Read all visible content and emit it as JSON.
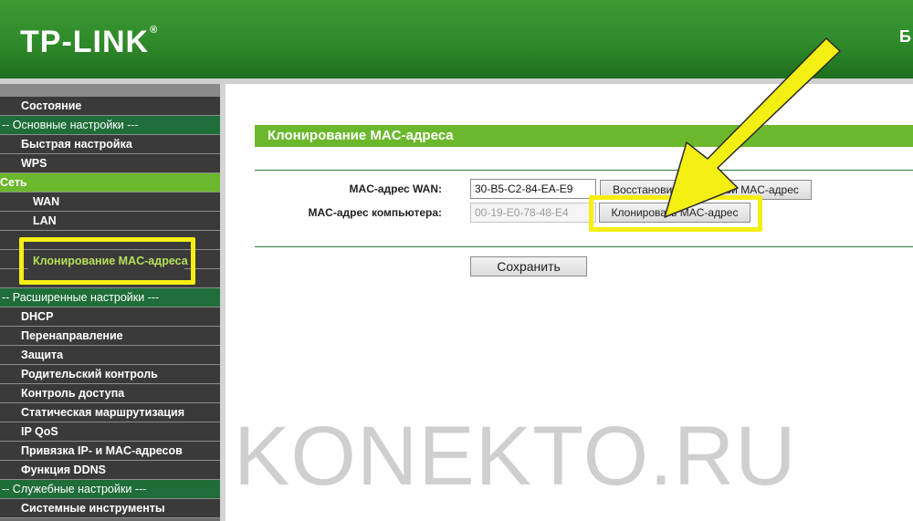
{
  "header": {
    "logo_text": "TP-LINK",
    "logo_mark": "®",
    "right_text": "Б"
  },
  "sidebar": {
    "items": [
      {
        "label": "Состояние",
        "type": "l1"
      },
      {
        "label": "-- Основные настройки ---",
        "type": "section"
      },
      {
        "label": "Быстрая настройка",
        "type": "l1"
      },
      {
        "label": "WPS",
        "type": "l1"
      },
      {
        "label": "Сеть",
        "type": "active"
      },
      {
        "label": "WAN",
        "type": "l2"
      },
      {
        "label": "LAN",
        "type": "l2"
      },
      {
        "label": "",
        "type": "blank"
      },
      {
        "label": "",
        "type": "blank"
      },
      {
        "label": "",
        "type": "blank"
      },
      {
        "label": "-- Расширенные настройки ---",
        "type": "section"
      },
      {
        "label": "DHCP",
        "type": "l1"
      },
      {
        "label": "Перенаправление",
        "type": "l1"
      },
      {
        "label": "Защита",
        "type": "l1"
      },
      {
        "label": "Родительский контроль",
        "type": "l1"
      },
      {
        "label": "Контроль доступа",
        "type": "l1"
      },
      {
        "label": "Статическая маршрутизация",
        "type": "l1"
      },
      {
        "label": "IP QoS",
        "type": "l1"
      },
      {
        "label": "Привязка IP- и MAC-адресов",
        "type": "l1"
      },
      {
        "label": "Функция DDNS",
        "type": "l1"
      },
      {
        "label": "-- Служебные настройки ---",
        "type": "section"
      },
      {
        "label": "Системные инструменты",
        "type": "l1"
      }
    ],
    "highlighted_item": "Клонирование MAC-адреса"
  },
  "main": {
    "title": "Клонирование MAC-адреса",
    "wan_mac_label": "MAC-адрес WAN:",
    "wan_mac_value": "30-B5-C2-84-EA-E9",
    "restore_button": "Восстановить заводской MAC-адрес",
    "pc_mac_label": "MAC-адрес компьютера:",
    "pc_mac_value": "00-19-E0-78-48-E4",
    "clone_button": "Клонировать MAC-адрес",
    "save_button": "Сохранить"
  },
  "watermark": "KONEKTO.RU",
  "colors": {
    "header_green": "#2f8a2a",
    "accent_green": "#6cb82c",
    "section_green": "#1f6d38",
    "highlight_yellow": "#f4ef12"
  }
}
